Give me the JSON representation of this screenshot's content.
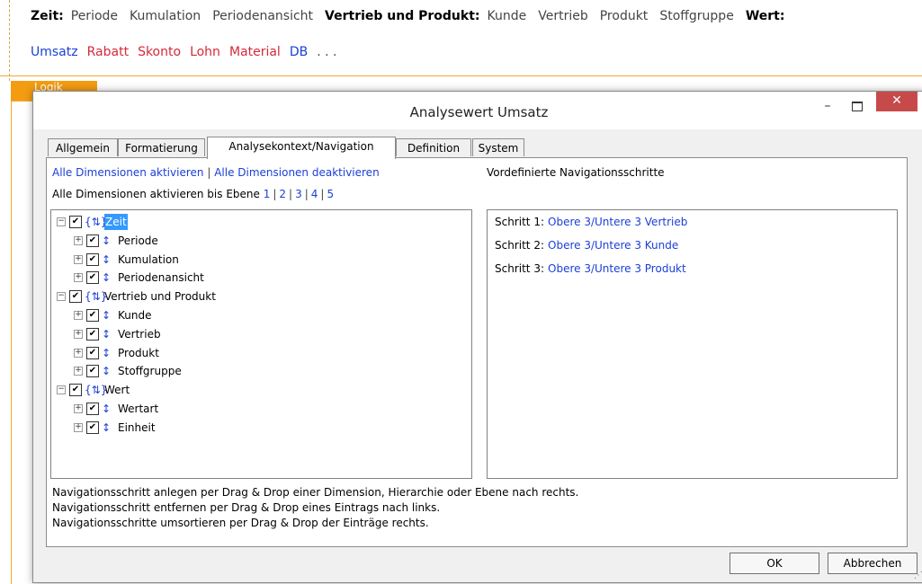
{
  "background": {
    "row1": [
      {
        "text": "Zeit:",
        "group": true
      },
      {
        "text": "Periode",
        "group": false
      },
      {
        "text": "Kumulation",
        "group": false
      },
      {
        "text": "Periodenansicht",
        "group": false
      },
      {
        "text": "Vertrieb und Produkt:",
        "group": true
      },
      {
        "text": "Kunde",
        "group": false
      },
      {
        "text": "Vertrieb",
        "group": false
      },
      {
        "text": "Produkt",
        "group": false
      },
      {
        "text": "Stoffgruppe",
        "group": false
      },
      {
        "text": "Wert:",
        "group": true
      }
    ],
    "row2": [
      {
        "text": "Umsatz",
        "color": "#1a3fd6"
      },
      {
        "text": "Rabatt",
        "color": "#d6283a"
      },
      {
        "text": "Skonto",
        "color": "#d6283a"
      },
      {
        "text": "Lohn",
        "color": "#d6283a"
      },
      {
        "text": "Material",
        "color": "#d6283a"
      },
      {
        "text": "DB",
        "color": "#1a3fd6"
      },
      {
        "text": ". . .",
        "color": "#444444"
      }
    ],
    "logik_tab": "Logik"
  },
  "dialog": {
    "title": "Analysewert Umsatz",
    "min_glyph": "–",
    "close_glyph": "✕",
    "tabs": [
      "Allgemein",
      "Formatierung",
      "Analysekontext/Navigation",
      "Definition",
      "System"
    ],
    "active_tab": "Analysekontext/Navigation",
    "activate_all": "Alle Dimensionen aktivieren",
    "separator": "|",
    "deactivate_all": "Alle Dimensionen deaktivieren",
    "level_prefix": "Alle Dimensionen aktivieren bis Ebene",
    "levels": [
      "1",
      "2",
      "3",
      "4",
      "5"
    ],
    "predefined_label": "Vordefinierte Navigationsschritte",
    "tree": [
      {
        "label": "Zeit",
        "depth": 0,
        "expanded": true,
        "selected": true,
        "checked": true,
        "icon": "{⇅}"
      },
      {
        "label": "Periode",
        "depth": 1,
        "expanded": false,
        "selected": false,
        "checked": true,
        "icon": "↕"
      },
      {
        "label": "Kumulation",
        "depth": 1,
        "expanded": false,
        "selected": false,
        "checked": true,
        "icon": "↕"
      },
      {
        "label": "Periodenansicht",
        "depth": 1,
        "expanded": false,
        "selected": false,
        "checked": true,
        "icon": "↕"
      },
      {
        "label": "Vertrieb und Produkt",
        "depth": 0,
        "expanded": true,
        "selected": false,
        "checked": true,
        "icon": "{⇅}"
      },
      {
        "label": "Kunde",
        "depth": 1,
        "expanded": false,
        "selected": false,
        "checked": true,
        "icon": "↕"
      },
      {
        "label": "Vertrieb",
        "depth": 1,
        "expanded": false,
        "selected": false,
        "checked": true,
        "icon": "↕"
      },
      {
        "label": "Produkt",
        "depth": 1,
        "expanded": false,
        "selected": false,
        "checked": true,
        "icon": "↕"
      },
      {
        "label": "Stoffgruppe",
        "depth": 1,
        "expanded": false,
        "selected": false,
        "checked": true,
        "icon": "↕"
      },
      {
        "label": "Wert",
        "depth": 0,
        "expanded": true,
        "selected": false,
        "checked": true,
        "icon": "{⇅}"
      },
      {
        "label": "Wertart",
        "depth": 1,
        "expanded": false,
        "selected": false,
        "checked": true,
        "icon": "↕"
      },
      {
        "label": "Einheit",
        "depth": 1,
        "expanded": false,
        "selected": false,
        "checked": true,
        "icon": "↕"
      }
    ],
    "steps": [
      {
        "prefix": "Schritt 1:",
        "link": "Obere 3/Untere 3 Vertrieb"
      },
      {
        "prefix": "Schritt 2:",
        "link": "Obere 3/Untere 3 Kunde"
      },
      {
        "prefix": "Schritt 3:",
        "link": "Obere 3/Untere 3 Produkt"
      }
    ],
    "hints": [
      "Navigationsschritt anlegen per Drag & Drop einer Dimension, Hierarchie oder Ebene nach rechts.",
      "Navigationsschritt entfernen per Drag & Drop eines Eintrags nach links.",
      "Navigationsschritte umsortieren per Drag & Drop der Einträge rechts."
    ],
    "ok_label": "OK",
    "cancel_label": "Abbrechen"
  }
}
